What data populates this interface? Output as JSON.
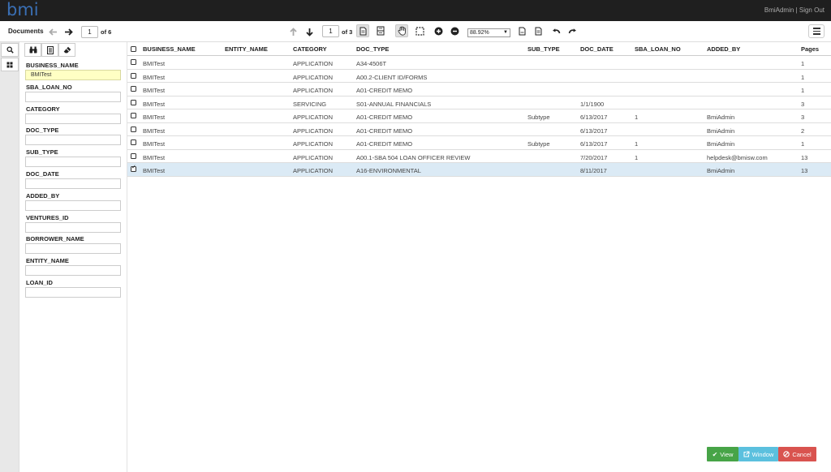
{
  "app": {
    "logo_text": "bmi",
    "logo_color": "#3a6fb4"
  },
  "user": {
    "name": "BmiAdmin",
    "separator": "|",
    "sign_out": "Sign Out"
  },
  "toolbar": {
    "documents_label": "Documents",
    "doc_index": "1",
    "doc_of": "of 6",
    "page_index": "1",
    "page_of": "of 3",
    "zoom": "88.92%"
  },
  "filters": [
    {
      "label": "BUSINESS_NAME",
      "value": "BMITest"
    },
    {
      "label": "SBA_LOAN_NO",
      "value": ""
    },
    {
      "label": "CATEGORY",
      "value": ""
    },
    {
      "label": "DOC_TYPE",
      "value": ""
    },
    {
      "label": "SUB_TYPE",
      "value": ""
    },
    {
      "label": "DOC_DATE",
      "value": ""
    },
    {
      "label": "ADDED_BY",
      "value": ""
    },
    {
      "label": "VENTURES_ID",
      "value": ""
    },
    {
      "label": "BORROWER_NAME",
      "value": ""
    },
    {
      "label": "ENTITY_NAME",
      "value": ""
    },
    {
      "label": "LOAN_ID",
      "value": ""
    }
  ],
  "grid": {
    "columns": [
      "BUSINESS_NAME",
      "ENTITY_NAME",
      "CATEGORY",
      "DOC_TYPE",
      "SUB_TYPE",
      "DOC_DATE",
      "SBA_LOAN_NO",
      "ADDED_BY",
      "Pages"
    ],
    "rows": [
      {
        "business": "BMITest",
        "entity": "",
        "category": "APPLICATION",
        "doc_type": "A34-4506T",
        "sub_type": "",
        "doc_date": "",
        "sba": "",
        "added_by": "",
        "pages": "1",
        "checked": false
      },
      {
        "business": "BMITest",
        "entity": "",
        "category": "APPLICATION",
        "doc_type": "A00.2-CLIENT ID/FORMS",
        "sub_type": "",
        "doc_date": "",
        "sba": "",
        "added_by": "",
        "pages": "1",
        "checked": false
      },
      {
        "business": "BMITest",
        "entity": "",
        "category": "APPLICATION",
        "doc_type": "A01-CREDIT MEMO",
        "sub_type": "",
        "doc_date": "",
        "sba": "",
        "added_by": "",
        "pages": "1",
        "checked": false
      },
      {
        "business": "BMITest",
        "entity": "",
        "category": "SERVICING",
        "doc_type": "S01-ANNUAL FINANCIALS",
        "sub_type": "",
        "doc_date": "1/1/1900",
        "sba": "",
        "added_by": "",
        "pages": "3",
        "checked": false
      },
      {
        "business": "BMITest",
        "entity": "",
        "category": "APPLICATION",
        "doc_type": "A01-CREDIT MEMO",
        "sub_type": "Subtype",
        "doc_date": "6/13/2017",
        "sba": "1",
        "added_by": "BmiAdmin",
        "pages": "3",
        "checked": false
      },
      {
        "business": "BMITest",
        "entity": "",
        "category": "APPLICATION",
        "doc_type": "A01-CREDIT MEMO",
        "sub_type": "",
        "doc_date": "6/13/2017",
        "sba": "",
        "added_by": "BmiAdmin",
        "pages": "2",
        "checked": false
      },
      {
        "business": "BMITest",
        "entity": "",
        "category": "APPLICATION",
        "doc_type": "A01-CREDIT MEMO",
        "sub_type": "Subtype",
        "doc_date": "6/13/2017",
        "sba": "1",
        "added_by": "BmiAdmin",
        "pages": "1",
        "checked": false
      },
      {
        "business": "BMITest",
        "entity": "",
        "category": "APPLICATION",
        "doc_type": "A00.1-SBA 504 LOAN OFFICER REVIEW",
        "sub_type": "",
        "doc_date": "7/20/2017",
        "sba": "1",
        "added_by": "helpdesk@bmisw.com",
        "pages": "13",
        "checked": false
      },
      {
        "business": "BMITest",
        "entity": "",
        "category": "APPLICATION",
        "doc_type": "A16-ENVIRONMENTAL",
        "sub_type": "",
        "doc_date": "8/11/2017",
        "sba": "",
        "added_by": "BmiAdmin",
        "pages": "13",
        "checked": true
      }
    ]
  },
  "buttons": {
    "view": "View",
    "window": "Window",
    "cancel": "Cancel"
  },
  "colors": {
    "view": "#47a447",
    "window": "#5bc0de",
    "cancel": "#d9534f",
    "selected_row": "#dbeaf5",
    "filled_filter": "#ffffc4"
  }
}
